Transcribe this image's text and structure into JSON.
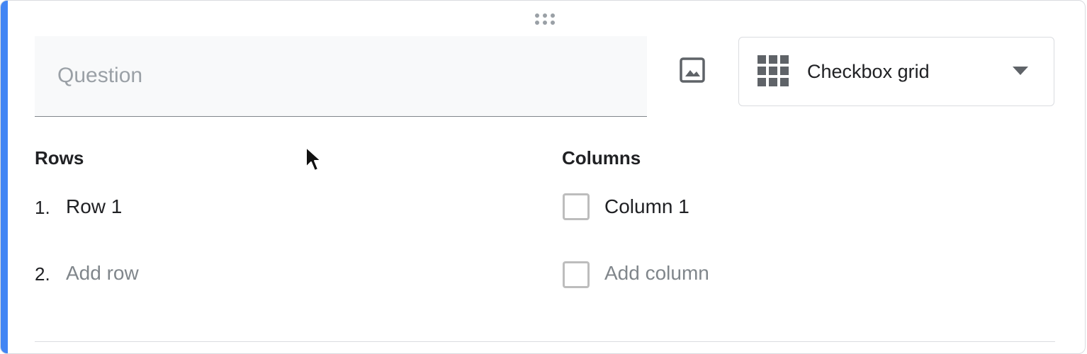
{
  "question": {
    "placeholder": "Question"
  },
  "toolbar": {
    "image_icon": "image-icon",
    "drag_icon": "drag-handle-icon"
  },
  "type_selector": {
    "icon": "grid-icon",
    "selected": "Checkbox grid"
  },
  "rows": {
    "heading": "Rows",
    "items": [
      {
        "number": "1.",
        "label": "Row 1"
      }
    ],
    "add": {
      "number": "2.",
      "label": "Add row"
    }
  },
  "columns": {
    "heading": "Columns",
    "items": [
      {
        "label": "Column 1"
      }
    ],
    "add": {
      "label": "Add column"
    }
  },
  "colors": {
    "accent": "#4285f4",
    "text": "#202124",
    "muted": "#80868b"
  }
}
